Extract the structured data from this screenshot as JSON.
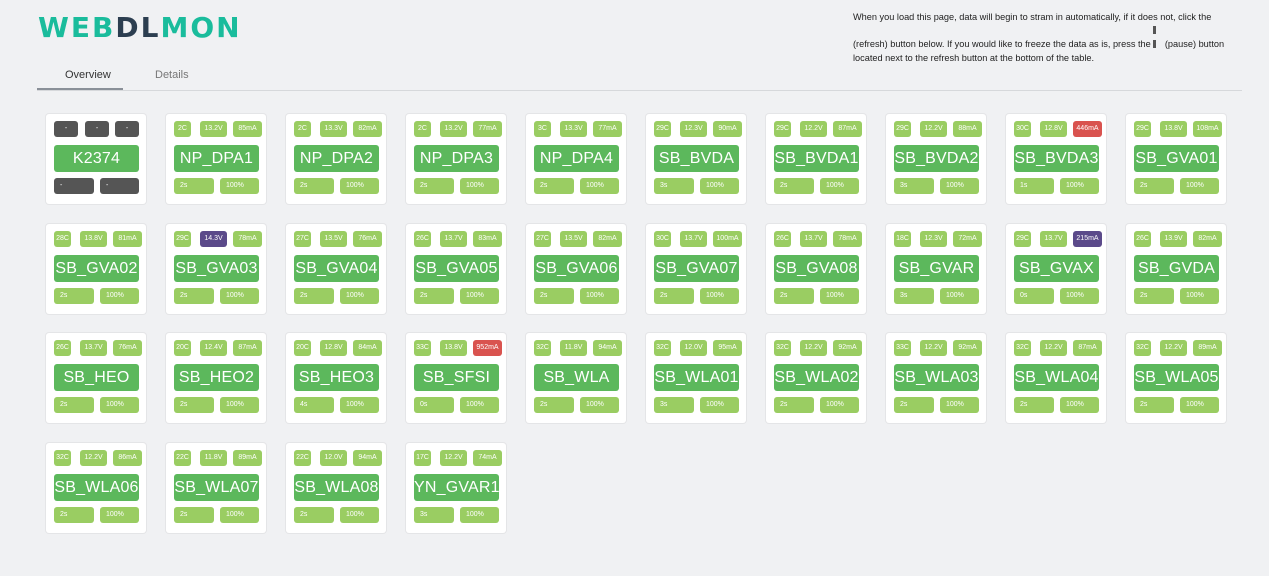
{
  "logo": {
    "part1": "WEB",
    "part2": "DL",
    "part3": "MON"
  },
  "info": {
    "text1": "When you load this page, data will begin to stram in automatically, if it does not, click the (refresh) button below. If you would like to freeze the data as is, press the",
    "text2": "(pause) button located next to the refresh button at the bottom of the table."
  },
  "tabs": [
    {
      "label": "Overview",
      "icon": "grid-large-icon",
      "active": true
    },
    {
      "label": "Details",
      "icon": "grid-small-icon",
      "active": false
    }
  ],
  "colors": {
    "ok": "#9acd62",
    "name": "#5cb85c",
    "alert": "#d9534f",
    "warn": "#5b4a8a",
    "nodata": "#555555",
    "logo_accent": "#1abc9c",
    "logo_dark": "#2c3e50"
  },
  "devices": [
    {
      "name": "K2374",
      "temp": "-",
      "volt": "-",
      "curr": "-",
      "interval": "-",
      "pct": "-",
      "nodata": true
    },
    {
      "name": "NP_DPA1",
      "temp": "2C",
      "volt": "13.2V",
      "curr": "85mA",
      "interval": "2s",
      "pct": "100%"
    },
    {
      "name": "NP_DPA2",
      "temp": "2C",
      "volt": "13.3V",
      "curr": "82mA",
      "interval": "2s",
      "pct": "100%"
    },
    {
      "name": "NP_DPA3",
      "temp": "2C",
      "volt": "13.2V",
      "curr": "77mA",
      "interval": "2s",
      "pct": "100%"
    },
    {
      "name": "NP_DPA4",
      "temp": "3C",
      "volt": "13.3V",
      "curr": "77mA",
      "interval": "2s",
      "pct": "100%"
    },
    {
      "name": "SB_BVDA",
      "temp": "29C",
      "volt": "12.3V",
      "curr": "90mA",
      "interval": "3s",
      "pct": "100%"
    },
    {
      "name": "SB_BVDA1",
      "temp": "29C",
      "volt": "12.2V",
      "curr": "87mA",
      "interval": "2s",
      "pct": "100%"
    },
    {
      "name": "SB_BVDA2",
      "temp": "29C",
      "volt": "12.2V",
      "curr": "88mA",
      "interval": "3s",
      "pct": "100%"
    },
    {
      "name": "SB_BVDA3",
      "temp": "30C",
      "volt": "12.8V",
      "curr": "446mA",
      "interval": "1s",
      "pct": "100%",
      "curr_state": "alert"
    },
    {
      "name": "SB_GVA01",
      "temp": "29C",
      "volt": "13.8V",
      "curr": "108mA",
      "interval": "2s",
      "pct": "100%"
    },
    {
      "name": "SB_GVA02",
      "temp": "28C",
      "volt": "13.8V",
      "curr": "81mA",
      "interval": "2s",
      "pct": "100%"
    },
    {
      "name": "SB_GVA03",
      "temp": "29C",
      "volt": "14.3V",
      "curr": "78mA",
      "interval": "2s",
      "pct": "100%",
      "volt_state": "warn"
    },
    {
      "name": "SB_GVA04",
      "temp": "27C",
      "volt": "13.5V",
      "curr": "76mA",
      "interval": "2s",
      "pct": "100%"
    },
    {
      "name": "SB_GVA05",
      "temp": "26C",
      "volt": "13.7V",
      "curr": "83mA",
      "interval": "2s",
      "pct": "100%"
    },
    {
      "name": "SB_GVA06",
      "temp": "27C",
      "volt": "13.5V",
      "curr": "82mA",
      "interval": "2s",
      "pct": "100%"
    },
    {
      "name": "SB_GVA07",
      "temp": "30C",
      "volt": "13.7V",
      "curr": "100mA",
      "interval": "2s",
      "pct": "100%"
    },
    {
      "name": "SB_GVA08",
      "temp": "26C",
      "volt": "13.7V",
      "curr": "78mA",
      "interval": "2s",
      "pct": "100%"
    },
    {
      "name": "SB_GVAR",
      "temp": "18C",
      "volt": "12.3V",
      "curr": "72mA",
      "interval": "3s",
      "pct": "100%"
    },
    {
      "name": "SB_GVAX",
      "temp": "29C",
      "volt": "13.7V",
      "curr": "215mA",
      "interval": "0s",
      "pct": "100%",
      "curr_state": "warn"
    },
    {
      "name": "SB_GVDA",
      "temp": "26C",
      "volt": "13.9V",
      "curr": "82mA",
      "interval": "2s",
      "pct": "100%"
    },
    {
      "name": "SB_HEO",
      "temp": "26C",
      "volt": "13.7V",
      "curr": "76mA",
      "interval": "2s",
      "pct": "100%"
    },
    {
      "name": "SB_HEO2",
      "temp": "20C",
      "volt": "12.4V",
      "curr": "87mA",
      "interval": "2s",
      "pct": "100%"
    },
    {
      "name": "SB_HEO3",
      "temp": "20C",
      "volt": "12.8V",
      "curr": "84mA",
      "interval": "4s",
      "pct": "100%"
    },
    {
      "name": "SB_SFSI",
      "temp": "33C",
      "volt": "13.8V",
      "curr": "952mA",
      "interval": "0s",
      "pct": "100%",
      "curr_state": "alert"
    },
    {
      "name": "SB_WLA",
      "temp": "32C",
      "volt": "11.8V",
      "curr": "94mA",
      "interval": "2s",
      "pct": "100%"
    },
    {
      "name": "SB_WLA01",
      "temp": "32C",
      "volt": "12.0V",
      "curr": "95mA",
      "interval": "3s",
      "pct": "100%"
    },
    {
      "name": "SB_WLA02",
      "temp": "32C",
      "volt": "12.2V",
      "curr": "92mA",
      "interval": "2s",
      "pct": "100%"
    },
    {
      "name": "SB_WLA03",
      "temp": "33C",
      "volt": "12.2V",
      "curr": "92mA",
      "interval": "2s",
      "pct": "100%"
    },
    {
      "name": "SB_WLA04",
      "temp": "32C",
      "volt": "12.2V",
      "curr": "87mA",
      "interval": "2s",
      "pct": "100%"
    },
    {
      "name": "SB_WLA05",
      "temp": "32C",
      "volt": "12.2V",
      "curr": "89mA",
      "interval": "2s",
      "pct": "100%"
    },
    {
      "name": "SB_WLA06",
      "temp": "32C",
      "volt": "12.2V",
      "curr": "86mA",
      "interval": "2s",
      "pct": "100%"
    },
    {
      "name": "SB_WLA07",
      "temp": "22C",
      "volt": "11.8V",
      "curr": "89mA",
      "interval": "2s",
      "pct": "100%"
    },
    {
      "name": "SB_WLA08",
      "temp": "22C",
      "volt": "12.0V",
      "curr": "94mA",
      "interval": "2s",
      "pct": "100%"
    },
    {
      "name": "YN_GVAR1",
      "temp": "17C",
      "volt": "12.2V",
      "curr": "74mA",
      "interval": "3s",
      "pct": "100%"
    }
  ]
}
